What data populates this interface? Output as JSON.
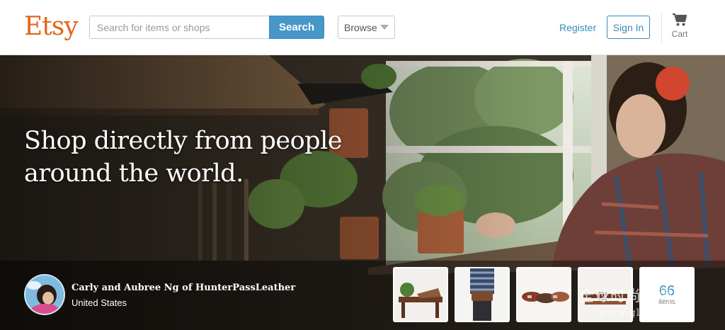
{
  "header": {
    "logo": "Etsy",
    "search": {
      "placeholder": "Search for items or shops",
      "value": "",
      "button_label": "Search"
    },
    "browse_label": "Browse",
    "register_label": "Register",
    "signin_label": "Sign In",
    "cart_label": "Cart"
  },
  "hero": {
    "headline_line1": "Shop directly from people",
    "headline_line2": "around the world.",
    "seller": {
      "name": "Carly and Aubree Ng of HunterPassLeather",
      "location": "United States"
    },
    "items_count": "66",
    "items_label": "items"
  },
  "watermark": {
    "cn_text": "全球时尚品牌网",
    "url_text": "www.glospp.com"
  },
  "colors": {
    "brand": "#e2661d",
    "accent": "#4798c9",
    "link": "#3a8bbb"
  },
  "icons": {
    "cart": "shopping-cart-icon",
    "browse": "chevron-down-icon"
  }
}
